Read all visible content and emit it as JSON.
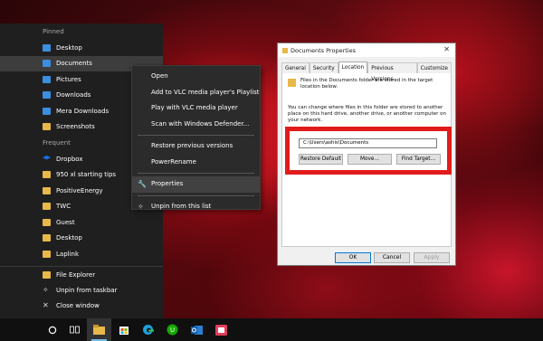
{
  "jumplist": {
    "pinned_header": "Pinned",
    "pinned": [
      {
        "label": "Desktop",
        "icon": "blue"
      },
      {
        "label": "Documents",
        "icon": "blue"
      },
      {
        "label": "Pictures",
        "icon": "blue"
      },
      {
        "label": "Downloads",
        "icon": "blue"
      },
      {
        "label": "Mera Downloads",
        "icon": "blue"
      },
      {
        "label": "Screenshots",
        "icon": "folder"
      }
    ],
    "frequent_header": "Frequent",
    "frequent": [
      {
        "label": "Dropbox",
        "icon": "drop"
      },
      {
        "label": "950 xl starting tips",
        "icon": "folder"
      },
      {
        "label": "PositiveEnergy",
        "icon": "folder"
      },
      {
        "label": "TWC",
        "icon": "folder"
      },
      {
        "label": "Guest",
        "icon": "folder"
      },
      {
        "label": "Desktop",
        "icon": "folder"
      },
      {
        "label": "Laplink",
        "icon": "folder"
      }
    ],
    "footer": {
      "file_explorer": "File Explorer",
      "unpin": "Unpin from taskbar",
      "close": "Close window"
    }
  },
  "context_menu": {
    "open": "Open",
    "add_vlc": "Add to VLC media player's Playlist",
    "play_vlc": "Play with VLC media player",
    "scan": "Scan with Windows Defender...",
    "restore": "Restore previous versions",
    "powerrename": "PowerRename",
    "properties": "Properties",
    "unpin": "Unpin from this list"
  },
  "dialog": {
    "title": "Documents Properties",
    "close_glyph": "✕",
    "tabs": [
      "General",
      "Security",
      "Location",
      "Previous Versions",
      "Customize"
    ],
    "active_tab": "Location",
    "text1": "Files in the Documents folder are stored in the target location below.",
    "text2": "You can change where files in this folder are stored to another place on this hard drive, another drive, or another computer on your network.",
    "path_value": "C:\\Users\\ashis\\Documents",
    "restore_default": "Restore Default",
    "move": "Move...",
    "find_target": "Find Target...",
    "ok": "OK",
    "cancel": "Cancel",
    "apply": "Apply"
  },
  "taskbar": {
    "icons": [
      "cortana-circle-icon",
      "task-view-icon",
      "file-explorer-icon",
      "store-icon",
      "edge-icon",
      "upwork-icon",
      "outlook-icon",
      "snip-icon"
    ]
  },
  "colors": {
    "highlight_box": "#e11b1b",
    "folder": "#e8b84a",
    "jumplist_bg": "#1f1f1f"
  }
}
